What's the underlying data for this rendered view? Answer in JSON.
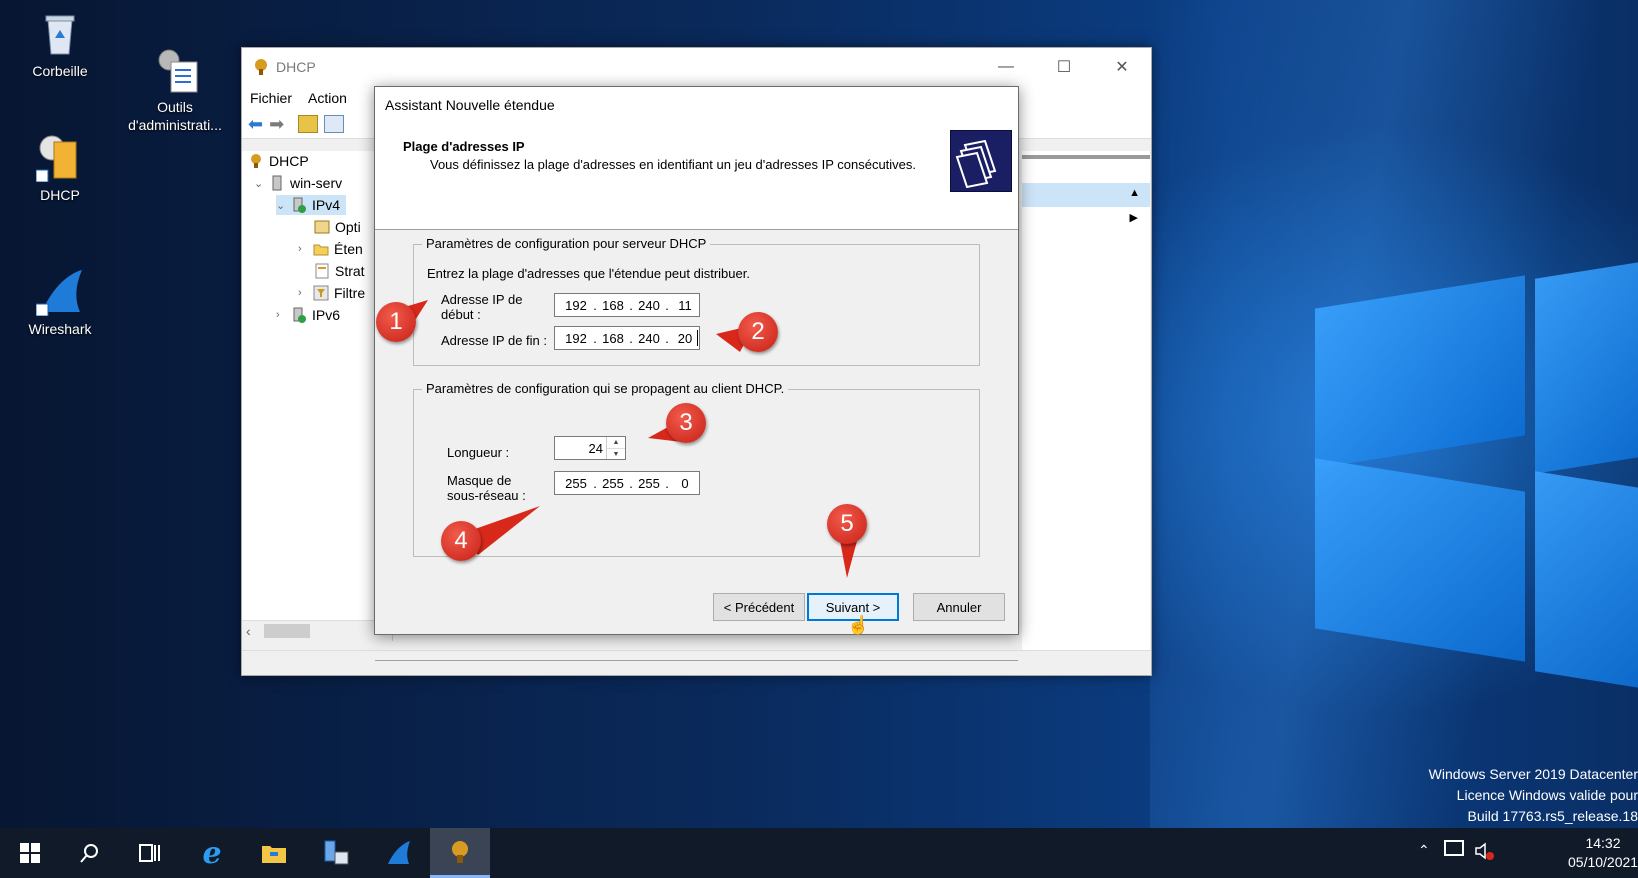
{
  "desktop": {
    "icons": [
      {
        "label": "Corbeille"
      },
      {
        "label": "Outils\nd'administrati..."
      },
      {
        "label": "DHCP"
      },
      {
        "label": "Wireshark"
      }
    ],
    "watermark": {
      "line1": "Windows Server 2019 Datacenter",
      "line2": "Licence Windows valide pour",
      "line3": "Build 17763.rs5_release.18"
    }
  },
  "mmc": {
    "title": "DHCP",
    "menu": [
      "Fichier",
      "Action"
    ],
    "tree": {
      "root": "DHCP",
      "server": "win-serv",
      "ipv4": "IPv4",
      "children": [
        "Opti",
        "Éten",
        "Strat",
        "Filtre"
      ],
      "ipv6": "IPv6"
    }
  },
  "wizard": {
    "title": "Assistant Nouvelle étendue",
    "heading": "Plage d'adresses IP",
    "subheading": "Vous définissez la plage d'adresses en identifiant un jeu d'adresses IP consécutives.",
    "server_group": {
      "legend": "Paramètres de configuration pour serveur DHCP",
      "instructions": "Entrez la plage d'adresses que l'étendue peut distribuer.",
      "start_label_1": "Adresse IP de",
      "start_label_2": "début :",
      "start_ip": [
        "192",
        "168",
        "240",
        "11"
      ],
      "end_label": "Adresse IP de fin :",
      "end_ip": [
        "192",
        "168",
        "240",
        "20"
      ]
    },
    "client_group": {
      "legend": "Paramètres de configuration qui se propagent au client DHCP.",
      "length_label": "Longueur :",
      "length_value": "24",
      "mask_label_1": "Masque de",
      "mask_label_2": "sous-réseau :",
      "mask": [
        "255",
        "255",
        "255",
        "0"
      ]
    },
    "buttons": {
      "back": "< Précédent",
      "next": "Suivant >",
      "cancel": "Annuler"
    }
  },
  "callouts": [
    "1",
    "2",
    "3",
    "4",
    "5"
  ],
  "taskbar": {
    "clock_time": "14:32",
    "clock_date": "05/10/2021"
  },
  "colors": {
    "callout_red": "#d8281a",
    "default_button_border": "#0078d7",
    "taskbar": "#111a29"
  }
}
